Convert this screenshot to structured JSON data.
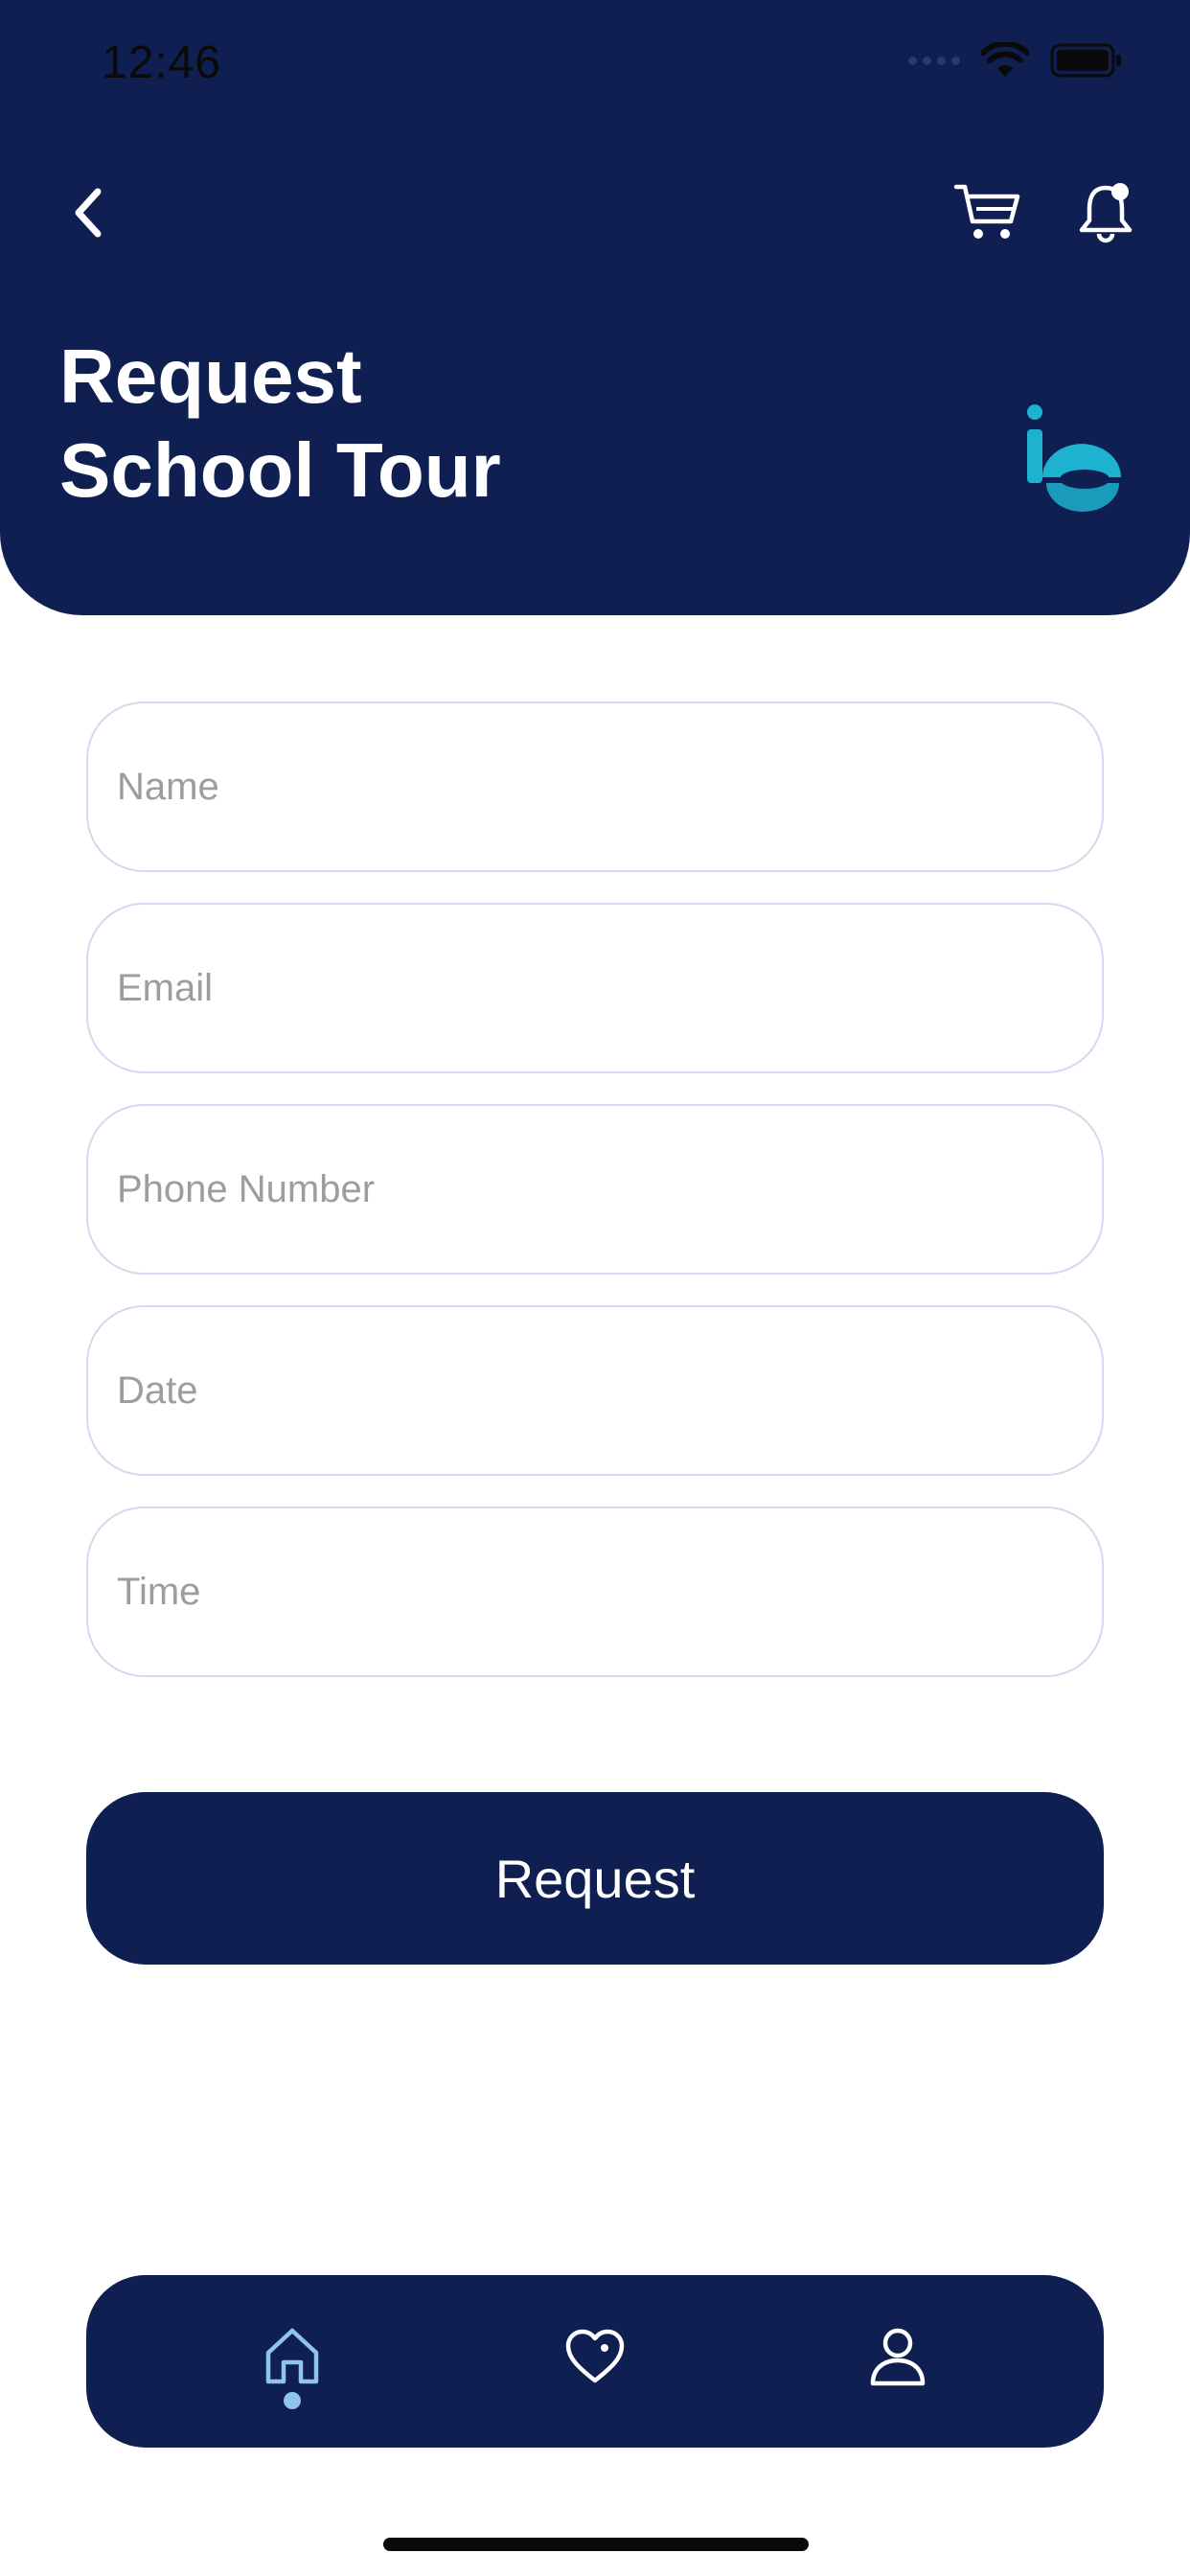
{
  "status_bar": {
    "time": "12:46"
  },
  "header": {
    "title_line1": "Request",
    "title_line2": "School Tour",
    "icons": {
      "back": "chevron-left-icon",
      "cart": "cart-icon",
      "notification": "bell-icon",
      "logo": "brand-logo"
    }
  },
  "form": {
    "name_placeholder": "Name",
    "email_placeholder": "Email",
    "phone_placeholder": "Phone Number",
    "date_placeholder": "Date",
    "time_placeholder": "Time",
    "submit_label": "Request"
  },
  "bottom_nav": {
    "items": [
      {
        "icon": "home-icon",
        "active": true
      },
      {
        "icon": "heart-icon",
        "active": false
      },
      {
        "icon": "user-icon",
        "active": false
      }
    ]
  },
  "colors": {
    "primary": "#0f1f52",
    "accent": "#1db2cf",
    "active_nav": "#8fc3f0",
    "field_border": "#d3d9ee",
    "placeholder": "#9d9d9d"
  }
}
